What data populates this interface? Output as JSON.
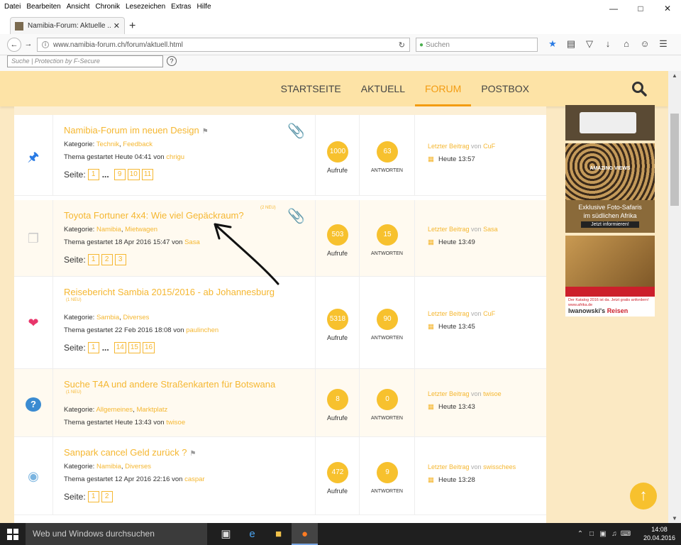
{
  "browser": {
    "menu": [
      "Datei",
      "Bearbeiten",
      "Ansicht",
      "Chronik",
      "Lesezeichen",
      "Extras",
      "Hilfe"
    ],
    "tab_title": "Namibia-Forum: Aktuelle ...",
    "url": "www.namibia-forum.ch/forum/aktuell.html",
    "search_placeholder": "Suchen",
    "fsecure_placeholder": "Suche | Protection by F-Secure",
    "fsecure_help": "?"
  },
  "site": {
    "nav": [
      {
        "label": "STARTSEITE"
      },
      {
        "label": "AKTUELL"
      },
      {
        "label": "FORUM",
        "active": true
      },
      {
        "label": "POSTBOX"
      }
    ]
  },
  "labels": {
    "category": "Kategorie:",
    "started": "Thema gestartet",
    "by": "von",
    "pages": "Seite:",
    "views": "Aufrufe",
    "replies": "ANTWORTEN",
    "last_post": "Letzter Beitrag",
    "dots": "..."
  },
  "topics": [
    {
      "icon": "pin-icon",
      "title": "Namibia-Forum im neuen Design",
      "flag": true,
      "badge": "",
      "attachment": true,
      "cat1": "Technik",
      "cat2": "Feedback",
      "started": "Heute 04:41",
      "author": "chrigu",
      "pages": [
        "1"
      ],
      "dots": true,
      "pages_end": [
        "9",
        "10",
        "11"
      ],
      "views": "1000",
      "replies": "63",
      "last_by": "CuF",
      "last_time": "Heute 13:57"
    },
    {
      "icon": "document-icon",
      "title": "Toyota Fortuner 4x4: Wie viel Gepäckraum?",
      "flag": false,
      "badge": "(2 NEU)",
      "attachment": true,
      "cat1": "Namibia",
      "cat2": "Mietwagen",
      "started": "18 Apr 2016 15:47",
      "author": "Sasa",
      "pages": [
        "1",
        "2",
        "3"
      ],
      "dots": false,
      "pages_end": [],
      "views": "503",
      "replies": "15",
      "last_by": "Sasa",
      "last_time": "Heute 13:49"
    },
    {
      "icon": "heart-icon",
      "title": "Reisebericht Sambia 2015/2016 - ab Johannesburg",
      "flag": false,
      "badge": "(1 NEU)",
      "attachment": false,
      "cat1": "Sambia",
      "cat2": "Diverses",
      "started": "22 Feb 2016 18:08",
      "author": "paulinchen",
      "pages": [
        "1"
      ],
      "dots": true,
      "pages_end": [
        "14",
        "15",
        "16"
      ],
      "views": "5318",
      "replies": "90",
      "last_by": "CuF",
      "last_time": "Heute 13:45"
    },
    {
      "icon": "question-icon",
      "title": "Suche T4A und andere Straßenkarten für Botswana",
      "flag": false,
      "badge": "(1 NEU)",
      "attachment": false,
      "cat1": "Allgemeines",
      "cat2": "Marktplatz",
      "started": "Heute 13:43",
      "author": "twisoe",
      "pages": [],
      "dots": false,
      "pages_end": [],
      "views": "8",
      "replies": "0",
      "last_by": "twisoe",
      "last_time": "Heute 13:43"
    },
    {
      "icon": "lightbulb-icon",
      "title": "Sanpark cancel Geld zurück ?",
      "flag": true,
      "badge": "",
      "attachment": false,
      "cat1": "Namibia",
      "cat2": "Diverses",
      "started": "12 Apr 2016 22:16",
      "author": "caspar",
      "pages": [
        "1",
        "2"
      ],
      "dots": false,
      "pages_end": [],
      "views": "472",
      "replies": "9",
      "last_by": "swisschees",
      "last_time": "Heute 13:28"
    }
  ],
  "ads": {
    "ad2_brand": "AMAZING VIEWS",
    "ad2_line1": "Exklusive Foto-Safaris",
    "ad2_line2": "im südlichen Afrika",
    "ad2_cta": "Jetzt informieren!",
    "ad3_text": "Der Katalog 2016 ist da. Jetzt gratis anfordern! www.afrika.de",
    "ad3_brand1": "Iwanowski's",
    "ad3_brand2": "Reisen"
  },
  "taskbar": {
    "search_placeholder": "Web und Windows durchsuchen",
    "time": "14:08",
    "date": "20.04.2016"
  }
}
